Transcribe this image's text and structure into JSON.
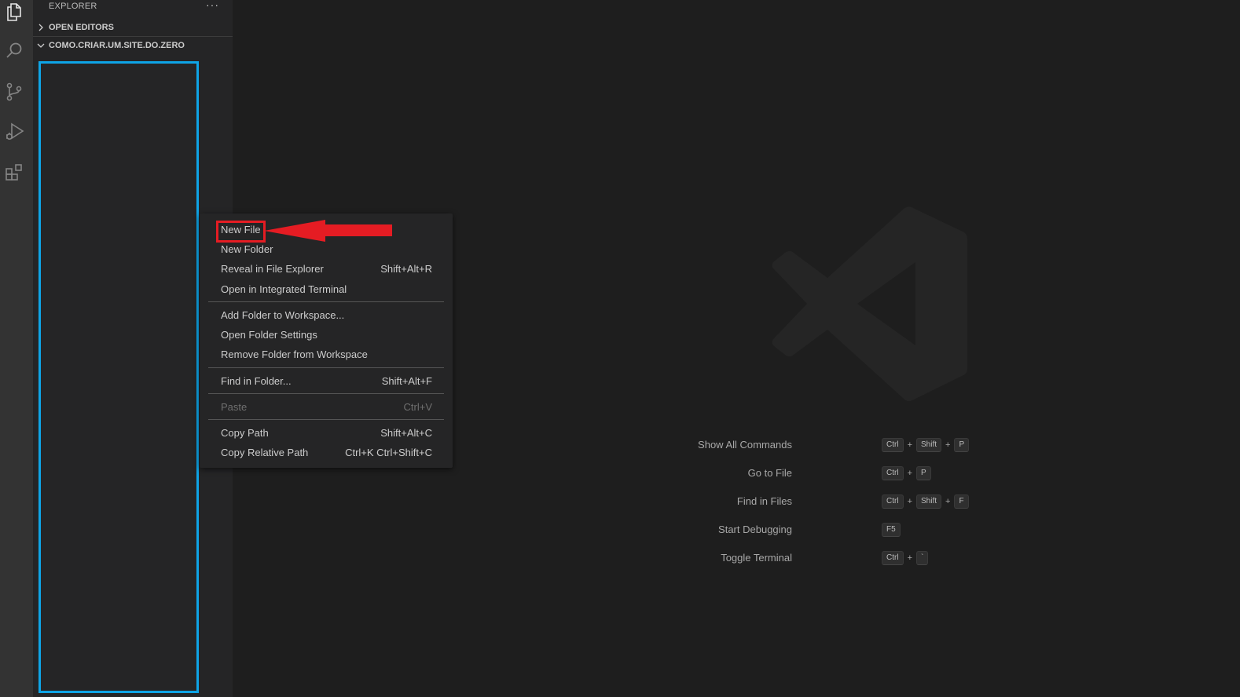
{
  "activity_bar": {
    "icons": [
      "files-icon",
      "search-icon",
      "source-control-icon",
      "run-debug-icon",
      "extensions-icon"
    ]
  },
  "sidebar": {
    "title": "EXPLORER",
    "more": "···",
    "sections": {
      "open_editors": "OPEN EDITORS",
      "folder": "COMO.CRIAR.UM.SITE.DO.ZERO"
    }
  },
  "context_menu": {
    "items": [
      {
        "label": "New File",
        "shortcut": ""
      },
      {
        "label": "New Folder",
        "shortcut": ""
      },
      {
        "label": "Reveal in File Explorer",
        "shortcut": "Shift+Alt+R"
      },
      {
        "label": "Open in Integrated Terminal",
        "shortcut": ""
      },
      {
        "label": "Add Folder to Workspace...",
        "shortcut": ""
      },
      {
        "label": "Open Folder Settings",
        "shortcut": ""
      },
      {
        "label": "Remove Folder from Workspace",
        "shortcut": ""
      },
      {
        "label": "Find in Folder...",
        "shortcut": "Shift+Alt+F"
      },
      {
        "label": "Paste",
        "shortcut": "Ctrl+V"
      },
      {
        "label": "Copy Path",
        "shortcut": "Shift+Alt+C"
      },
      {
        "label": "Copy Relative Path",
        "shortcut": "Ctrl+K Ctrl+Shift+C"
      }
    ]
  },
  "shortcuts": [
    {
      "label": "Show All Commands",
      "keys": [
        "Ctrl",
        "Shift",
        "P"
      ]
    },
    {
      "label": "Go to File",
      "keys": [
        "Ctrl",
        "P"
      ]
    },
    {
      "label": "Find in Files",
      "keys": [
        "Ctrl",
        "Shift",
        "F"
      ]
    },
    {
      "label": "Start Debugging",
      "keys": [
        "F5"
      ]
    },
    {
      "label": "Toggle Terminal",
      "keys": [
        "Ctrl",
        "`"
      ]
    }
  ],
  "colors": {
    "annotation_highlight": "#e51c23",
    "folder_highlight": "#0ea4e6",
    "background": "#1e1e1e",
    "sidebar": "#252526",
    "activity_bar": "#333333"
  }
}
